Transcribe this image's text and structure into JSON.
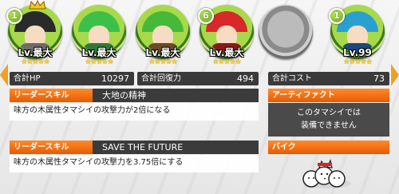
{
  "characters": [
    {
      "badge": "1",
      "level": "Lv.最大",
      "stars": "★★★★★",
      "hair_color": "#2a2a2a",
      "body_color": "#6b6b6b",
      "crown": true
    },
    {
      "badge": "",
      "level": "Lv.最大",
      "stars": "★★★★★",
      "hair_color": "#3cc04a",
      "body_color": "#2f7a3a",
      "crown": false
    },
    {
      "badge": "",
      "level": "Lv.最大",
      "stars": "★★★★★",
      "hair_color": "#46b83a",
      "body_color": "#6b4a2a",
      "crown": false
    },
    {
      "badge": "6",
      "level": "Lv.最大",
      "stars": "★★★★★",
      "hair_color": "#d8282a",
      "body_color": "#8a1a1a",
      "crown": false
    },
    {
      "badge": "1",
      "level": "Lv.99",
      "stars": "★★★★★",
      "hair_color": "#2aa0d0",
      "body_color": "#1a4a7a",
      "crown": false
    }
  ],
  "stats": {
    "hp_label": "合計HP",
    "hp_value": "10297",
    "heal_label": "合計回復力",
    "heal_value": "494",
    "cost_label": "合計コスト",
    "cost_value": "73"
  },
  "leader_skill_1": {
    "tag": "リーダースキル",
    "name": "大地の精神",
    "desc": "味方の木属性タマシイの攻撃力が2倍になる"
  },
  "leader_skill_2": {
    "tag": "リーダースキル",
    "name": "SAVE THE FUTURE",
    "desc": "味方の木属性タマシイの攻撃力を3.75倍にする"
  },
  "artifact": {
    "tag": "アーティファクト",
    "line1": "このタマシイでは",
    "line2": "装備できません"
  },
  "bike": {
    "tag": "バイク"
  },
  "colors": {
    "accent_orange": "#f07a10",
    "dark_panel": "#3b3b3b",
    "badge_green": "#7cc21e"
  }
}
